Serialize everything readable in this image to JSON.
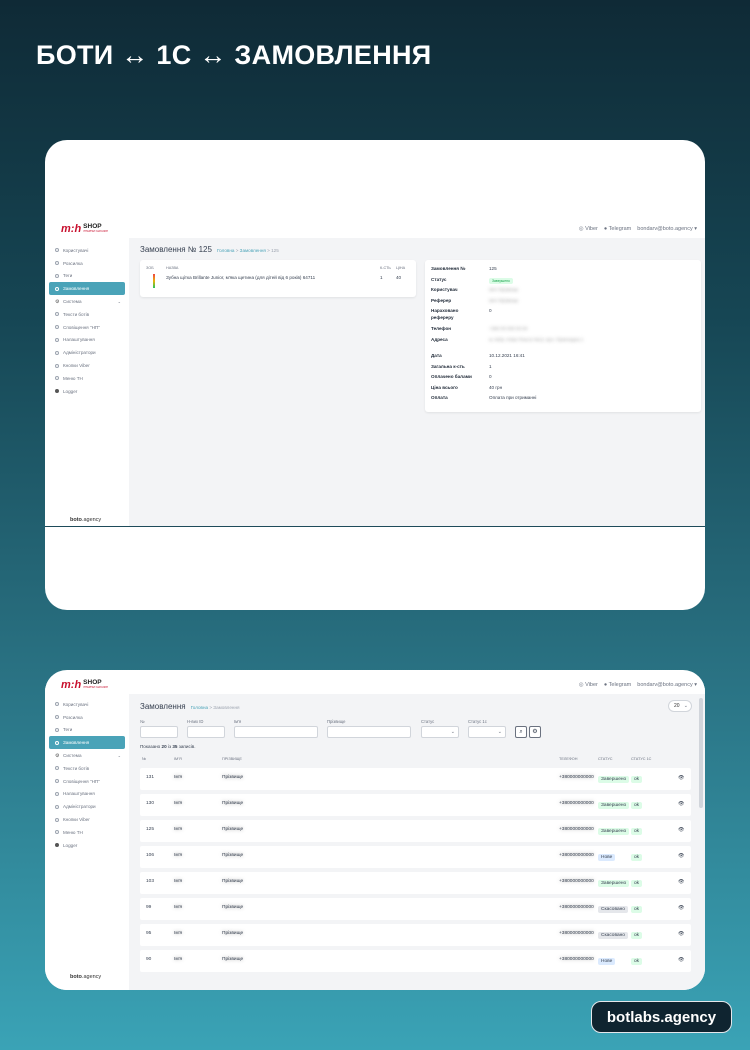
{
  "headline": "БОТИ ↔ 1С ↔ ЗАМОВЛЕННЯ",
  "brand": "botlabs.agency",
  "logo": {
    "mark": "m:h",
    "shop": "SHOP",
    "sub": "ІНТЕРНЕТ-МАГАЗИН"
  },
  "topbar": {
    "viber": "Viber",
    "telegram": "Telegram",
    "user": "bondarv@boto.agency"
  },
  "sidebar": {
    "items": [
      "Користувачі",
      "Розсилка",
      "Теги",
      "Замовлення",
      "Система",
      "Тексти ботів",
      "Сповіщення \"НП\"",
      "Налаштування",
      "Адміністратори",
      "Кнопки Viber",
      "Меню TH",
      "Logger"
    ],
    "active": "Замовлення",
    "footer_bold": "boto",
    "footer_rest": ".agency"
  },
  "order": {
    "title": "Замовлення № 125",
    "breadcrumb": {
      "home": "Головна",
      "section": "Замовлення",
      "current": "125",
      "sep": ">"
    },
    "items_headers": {
      "img": "ЗОБ",
      "name": "НАЗВА",
      "qty": "К-СТЬ",
      "price": "ЦІНА"
    },
    "items": [
      {
        "name": "Зубна щітка Brillante Junior, м'яка щетина (для дітей від 6 років) 64711",
        "qty": "1",
        "price": "40"
      }
    ],
    "details": [
      {
        "k": "Замовлення №",
        "v": "125"
      },
      {
        "k": "Статус",
        "v": "Завершено",
        "badge": true
      },
      {
        "k": "Користувач",
        "v": "Ім'я Прізвище",
        "blur": true
      },
      {
        "k": "Реферер",
        "v": "Ім'я Прізвище",
        "blur": true
      },
      {
        "k": "Нараховано рефереру",
        "v": "0"
      },
      {
        "k": "Телефон",
        "v": "+380 00 000 00 00",
        "blur": true
      },
      {
        "k": "Адреса",
        "v": "м. Київ, Нова Пошта №12, вул. Прикладна 1",
        "blur": true
      },
      {
        "k": "Дата",
        "v": "10.12.2021 16:41"
      },
      {
        "k": "Загальна к-сть",
        "v": "1"
      },
      {
        "k": "Оплачено балами",
        "v": "0"
      },
      {
        "k": "Ціна всього",
        "v": "40 грн"
      },
      {
        "k": "Оплата",
        "v": "Оплата при отриманні"
      }
    ]
  },
  "list": {
    "title": "Замовлення",
    "breadcrumb": {
      "home": "Головна",
      "section": "Замовлення",
      "sep": ">"
    },
    "page_size": "20",
    "filters": {
      "num": "№",
      "ext": "Н-вих ID",
      "name": "Ім'я",
      "surname": "Прізвище",
      "status": "Статус",
      "status1c": "Статус 1с"
    },
    "shown": {
      "prefix": "Показано",
      "count": "20",
      "mid": "із",
      "total": "35",
      "suffix": "записів."
    },
    "headers": {
      "num": "№",
      "name": "ІМ'Я",
      "surname": "ПРІЗВИЩЕ",
      "phone": "ТЕЛЕФОН",
      "status": "СТАТУС",
      "status1c": "СТАТУС 1С"
    },
    "rows": [
      {
        "num": "131",
        "name": "Ім'я",
        "surname": "Прізвище",
        "phone": "+380000000000",
        "status": "Завершено",
        "st": "green",
        "s1c": "ok"
      },
      {
        "num": "130",
        "name": "Ім'я",
        "surname": "Прізвище",
        "phone": "+380000000000",
        "status": "Завершено",
        "st": "green",
        "s1c": "ok"
      },
      {
        "num": "125",
        "name": "Ім'я",
        "surname": "Прізвище",
        "phone": "+380000000000",
        "status": "Завершено",
        "st": "green",
        "s1c": "ok"
      },
      {
        "num": "106",
        "name": "Ім'я",
        "surname": "Прізвище",
        "phone": "+380000000000",
        "status": "Нове",
        "st": "blue",
        "s1c": "ok"
      },
      {
        "num": "103",
        "name": "Ім'я",
        "surname": "Прізвище",
        "phone": "+380000000000",
        "status": "Завершено",
        "st": "green",
        "s1c": "ok"
      },
      {
        "num": "99",
        "name": "Ім'я",
        "surname": "Прізвище",
        "phone": "+380000000000",
        "status": "Скасовано",
        "st": "gray",
        "s1c": "ok"
      },
      {
        "num": "95",
        "name": "Ім'я",
        "surname": "Прізвище",
        "phone": "+380000000000",
        "status": "Скасовано",
        "st": "gray",
        "s1c": "ok"
      },
      {
        "num": "90",
        "name": "Ім'я",
        "surname": "Прізвище",
        "phone": "+380000000000",
        "status": "Нове",
        "st": "blue",
        "s1c": "ok"
      }
    ]
  }
}
